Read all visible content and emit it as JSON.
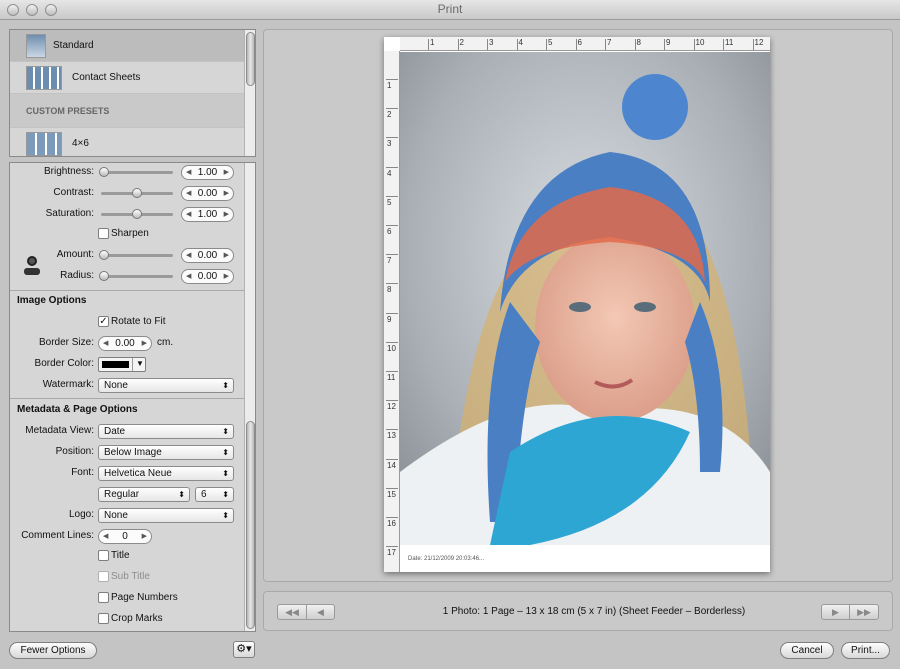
{
  "window": {
    "title": "Print"
  },
  "presets": {
    "items": [
      {
        "label": "Standard",
        "selected": true
      },
      {
        "label": "Contact Sheets",
        "selected": false
      }
    ],
    "custom_header": "CUSTOM PRESETS",
    "custom_items": [
      {
        "label": "4×6"
      }
    ]
  },
  "adjustments": {
    "brightness": {
      "label": "Brightness:",
      "value": "1.00"
    },
    "contrast": {
      "label": "Contrast:",
      "value": "0.00"
    },
    "saturation": {
      "label": "Saturation:",
      "value": "1.00"
    },
    "sharpen": {
      "label": "Sharpen",
      "checked": false
    },
    "amount": {
      "label": "Amount:",
      "value": "0.00"
    },
    "radius": {
      "label": "Radius:",
      "value": "0.00"
    }
  },
  "image_options": {
    "header": "Image Options",
    "rotate_to_fit": {
      "label": "Rotate to Fit",
      "checked": true
    },
    "border_size": {
      "label": "Border Size:",
      "value": "0.00",
      "unit": "cm."
    },
    "border_color": {
      "label": "Border Color:",
      "color": "#000000"
    },
    "watermark": {
      "label": "Watermark:",
      "value": "None"
    }
  },
  "metadata": {
    "header": "Metadata & Page Options",
    "view": {
      "label": "Metadata View:",
      "value": "Date"
    },
    "position": {
      "label": "Position:",
      "value": "Below Image"
    },
    "font": {
      "label": "Font:",
      "value": "Helvetica Neue"
    },
    "font_style": {
      "value": "Regular"
    },
    "font_size": {
      "value": "6"
    },
    "logo": {
      "label": "Logo:",
      "value": "None"
    },
    "comment_lines": {
      "label": "Comment Lines:",
      "value": "0"
    },
    "title": {
      "label": "Title",
      "checked": false
    },
    "subtitle": {
      "label": "Sub Title",
      "checked": false,
      "disabled": true
    },
    "page_numbers": {
      "label": "Page Numbers",
      "checked": false
    },
    "crop_marks": {
      "label": "Crop Marks",
      "checked": false
    }
  },
  "preview": {
    "ruler_h": [
      "1",
      "2",
      "3",
      "4",
      "5",
      "6",
      "7",
      "8",
      "9",
      "10",
      "11",
      "12"
    ],
    "ruler_v": [
      "1",
      "2",
      "3",
      "4",
      "5",
      "6",
      "7",
      "8",
      "9",
      "10",
      "11",
      "12",
      "13",
      "14",
      "15",
      "16",
      "17"
    ],
    "caption": "Date: 21/12/2009 20:03:46..."
  },
  "footer": {
    "page_info": "1 Photo: 1 Page – 13 x 18 cm (5 x 7 in) (Sheet Feeder – Borderless)",
    "nav_first": "◀◀",
    "nav_prev": "◀",
    "nav_next": "▶",
    "nav_last": "▶▶",
    "fewer_options": "Fewer Options",
    "gear": "⚙▾",
    "cancel": "Cancel",
    "print": "Print..."
  },
  "colors": {
    "selected_row": "#c4c4c4",
    "window_bg": "#c4c4c4"
  }
}
